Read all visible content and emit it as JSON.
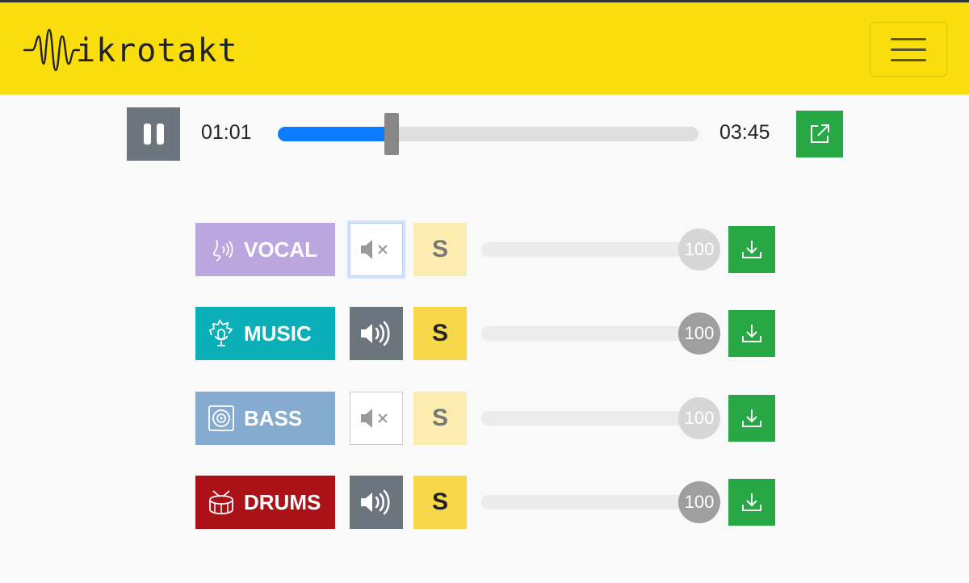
{
  "app": {
    "name": "ikrotakt"
  },
  "header": {
    "menu_icon": "hamburger-menu-icon"
  },
  "player": {
    "current_time": "01:01",
    "total_time": "03:45",
    "progress": 0.271,
    "pause_icon": "pause-icon",
    "external_icon": "external-link-icon"
  },
  "stems": [
    {
      "label": "VOCAL",
      "icon": "singer-icon",
      "color": "#bba6df",
      "muted": true,
      "solo": false,
      "volume": "100",
      "download_icon": "download-icon"
    },
    {
      "label": "MUSIC",
      "icon": "instrument-mic-icon",
      "color": "#0aafb8",
      "muted": false,
      "solo": true,
      "volume": "100",
      "download_icon": "download-icon"
    },
    {
      "label": "BASS",
      "icon": "speaker-icon",
      "color": "#85abd0",
      "muted": true,
      "solo": false,
      "volume": "100",
      "download_icon": "download-icon"
    },
    {
      "label": "DRUMS",
      "icon": "drum-icon",
      "color": "#aa1217",
      "muted": false,
      "solo": true,
      "volume": "100",
      "download_icon": "download-icon"
    }
  ],
  "solo_label": "S",
  "colors": {
    "header": "#fadd0d",
    "accent": "#0d7bff",
    "download": "#28a745",
    "button_gray": "#6c757d"
  }
}
